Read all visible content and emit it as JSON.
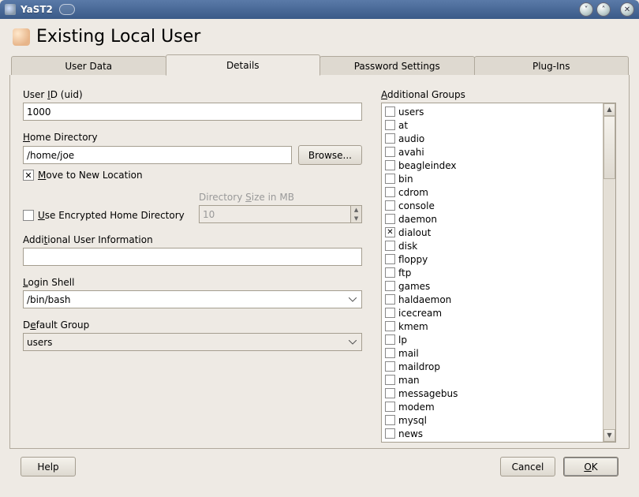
{
  "window": {
    "title": "YaST2"
  },
  "page_title": "Existing Local User",
  "tabs": [
    {
      "label": "User Data"
    },
    {
      "label": "Details"
    },
    {
      "label": "Password Settings"
    },
    {
      "label": "Plug-Ins"
    }
  ],
  "active_tab": "Details",
  "uid": {
    "label_pre": "User ",
    "label_u": "I",
    "label_post": "D (uid)",
    "value": "1000"
  },
  "home": {
    "label_pre": "",
    "label_u": "H",
    "label_post": "ome Directory",
    "value": "/home/joe"
  },
  "browse_label": "Browse...",
  "move_cb": {
    "label_pre": "",
    "label_u": "M",
    "label_post": "ove to New Location",
    "checked": true
  },
  "enc_cb": {
    "label_pre": "",
    "label_u": "U",
    "label_post": "se Encrypted Home Directory",
    "checked": false
  },
  "dirsize": {
    "label_pre": "Directory ",
    "label_u": "S",
    "label_post": "ize in MB",
    "value": "10",
    "enabled": false
  },
  "addl_info": {
    "label_pre": "Addi",
    "label_u": "t",
    "label_post": "ional User Information",
    "value": ""
  },
  "shell": {
    "label_pre": "",
    "label_u": "L",
    "label_post": "ogin Shell",
    "value": "/bin/bash"
  },
  "defgroup": {
    "label_pre": "D",
    "label_u": "e",
    "label_post": "fault Group",
    "value": "users"
  },
  "addl_groups_label": {
    "pre": "",
    "u": "A",
    "post": "dditional Groups"
  },
  "groups": [
    {
      "name": "users",
      "checked": false
    },
    {
      "name": "at",
      "checked": false
    },
    {
      "name": "audio",
      "checked": false
    },
    {
      "name": "avahi",
      "checked": false
    },
    {
      "name": "beagleindex",
      "checked": false
    },
    {
      "name": "bin",
      "checked": false
    },
    {
      "name": "cdrom",
      "checked": false
    },
    {
      "name": "console",
      "checked": false
    },
    {
      "name": "daemon",
      "checked": false
    },
    {
      "name": "dialout",
      "checked": true
    },
    {
      "name": "disk",
      "checked": false
    },
    {
      "name": "floppy",
      "checked": false
    },
    {
      "name": "ftp",
      "checked": false
    },
    {
      "name": "games",
      "checked": false
    },
    {
      "name": "haldaemon",
      "checked": false
    },
    {
      "name": "icecream",
      "checked": false
    },
    {
      "name": "kmem",
      "checked": false
    },
    {
      "name": "lp",
      "checked": false
    },
    {
      "name": "mail",
      "checked": false
    },
    {
      "name": "maildrop",
      "checked": false
    },
    {
      "name": "man",
      "checked": false
    },
    {
      "name": "messagebus",
      "checked": false
    },
    {
      "name": "modem",
      "checked": false
    },
    {
      "name": "mysql",
      "checked": false
    },
    {
      "name": "news",
      "checked": false
    }
  ],
  "footer": {
    "help": "Help",
    "cancel": "Cancel",
    "ok_u": "O",
    "ok_post": "K"
  }
}
